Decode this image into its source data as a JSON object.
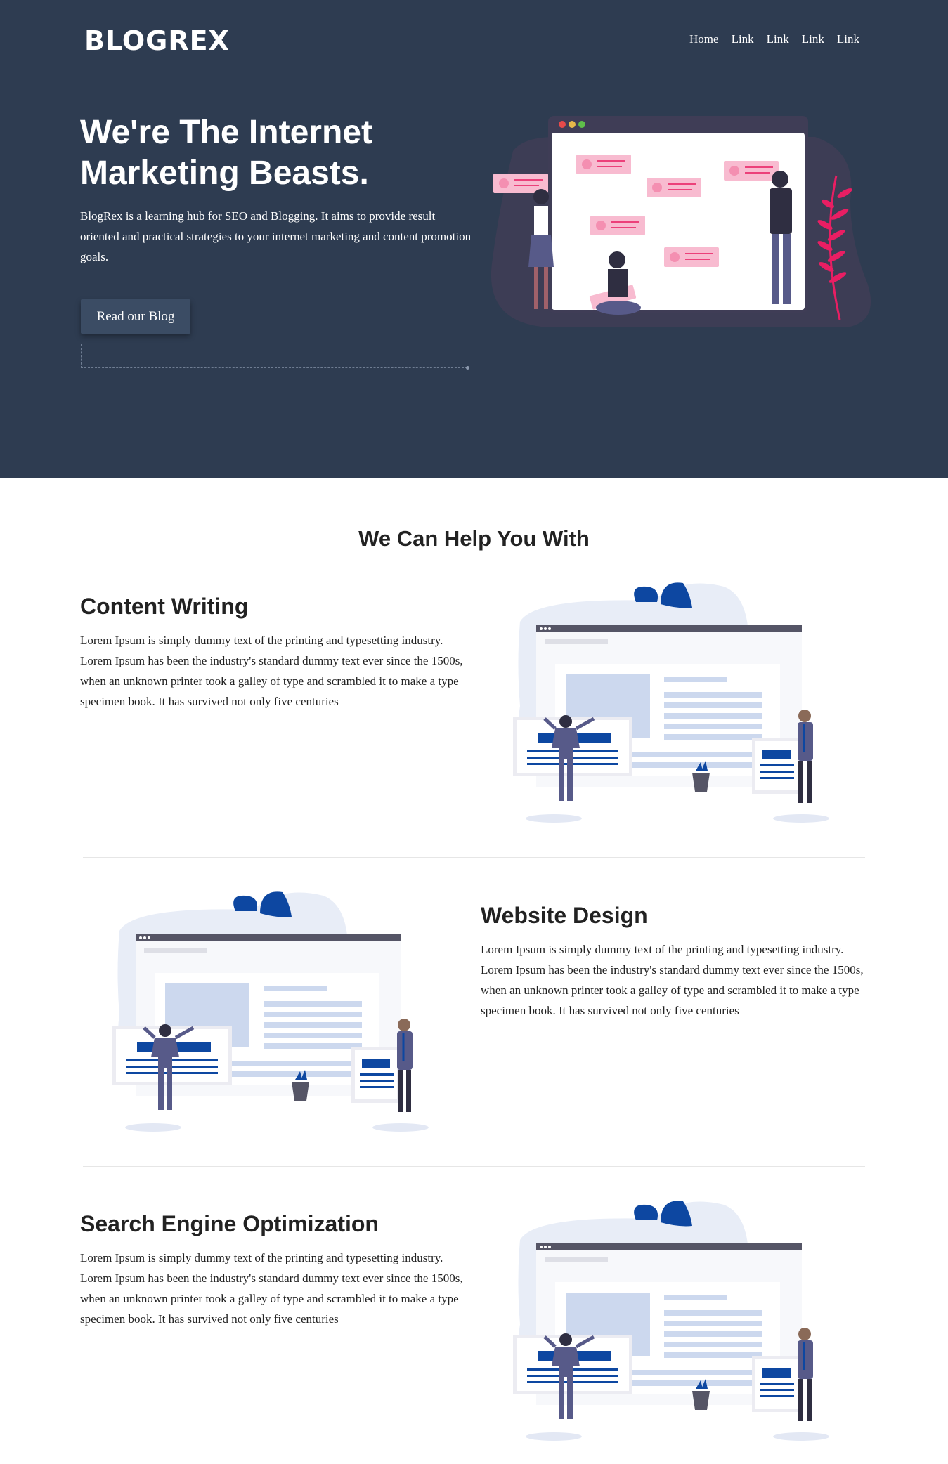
{
  "header": {
    "logo": {
      "part1": "BLOG",
      "part2": "REX"
    },
    "nav": [
      "Home",
      "Link",
      "Link",
      "Link",
      "Link"
    ]
  },
  "hero": {
    "title": "We're The Internet Marketing Beasts.",
    "description": "BlogRex is a learning hub for SEO and Blogging. It aims to provide result oriented and practical strategies to your internet marketing and content promotion goals.",
    "button_label": "Read our Blog"
  },
  "services": {
    "heading": "We Can Help You With",
    "items": [
      {
        "title": "Content Writing",
        "text": "Lorem Ipsum is simply dummy text of the printing and typesetting industry. Lorem Ipsum has been the industry's standard dummy text ever since the 1500s, when an unknown printer took a galley of type and scrambled it to make a type specimen book. It has survived not only five centuries"
      },
      {
        "title": "Website Design",
        "text": "Lorem Ipsum is simply dummy text of the printing and typesetting industry. Lorem Ipsum has been the industry's standard dummy text ever since the 1500s, when an unknown printer took a galley of type and scrambled it to make a type specimen book. It has survived not only five centuries"
      },
      {
        "title": "Search Engine Optimization",
        "text": "Lorem Ipsum is simply dummy text of the printing and typesetting industry. Lorem Ipsum has been the industry's standard dummy text ever since the 1500s, when an unknown printer took a galley of type and scrambled it to make a type specimen book. It has survived not only five centuries"
      }
    ]
  },
  "colors": {
    "hero_bg": "#2e3c51",
    "accent_blue": "#0d47a1",
    "accent_pink": "#f8bbd0",
    "logo_accent": "#e05a1e"
  }
}
